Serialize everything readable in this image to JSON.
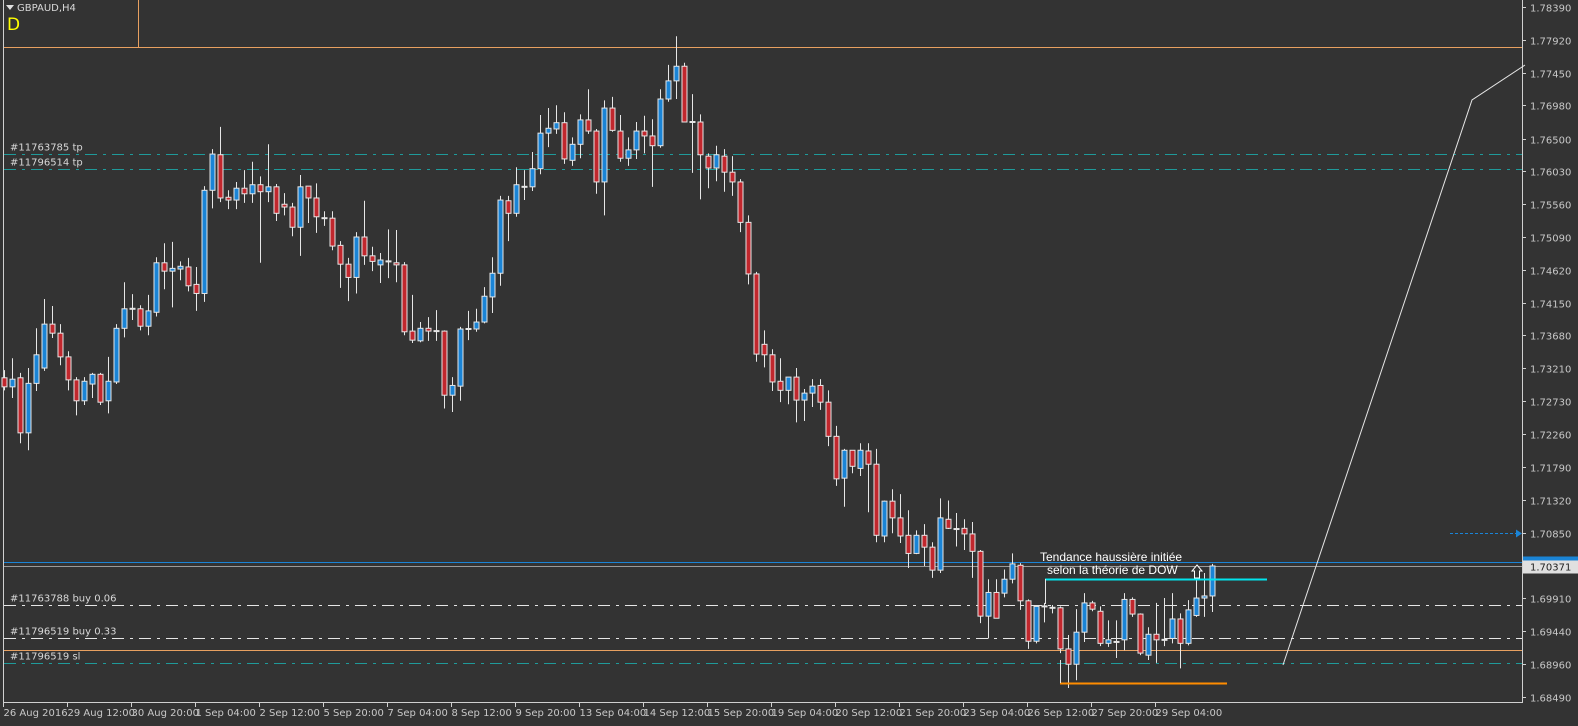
{
  "header": {
    "symbol": "GBPAUD,H4",
    "timeframe_marker": "D"
  },
  "colors": {
    "background": "#333333",
    "bull": "#1a84d6",
    "bear": "#c1272d",
    "candle_outline": "#e6e6e6",
    "axis_text": "#c8c8c8"
  },
  "annotation": {
    "line1": "Tendance haussière initiée",
    "line2": "selon la théorie de DOW",
    "arrow_icon": "up-arrow"
  },
  "current_price": {
    "bid": "1.70371",
    "bid_value": 1.70371,
    "ask_value": 1.7043
  },
  "alert_level": 1.7085,
  "order_lines": [
    {
      "label": "#11763785 tp",
      "price": 1.7628,
      "color": "#1f9a9a",
      "style": "dashdot"
    },
    {
      "label": "#11796514 tp",
      "price": 1.7606,
      "color": "#1f9a9a",
      "style": "dashdot"
    },
    {
      "label": "#11763788 buy 0.06",
      "price": 1.6981,
      "color": "#e6e6e6",
      "style": "dashdot"
    },
    {
      "label": "#11796519 buy 0.33",
      "price": 1.6933,
      "color": "#e6e6e6",
      "style": "dashdot"
    },
    {
      "label": "#11796519 sl",
      "price": 1.6898,
      "color": "#1f9a9a",
      "style": "dashdot"
    }
  ],
  "horizontal_lines": [
    {
      "price": 1.7782,
      "color": "#e8a060"
    },
    {
      "price": 1.6916,
      "color": "#e8a060"
    }
  ],
  "chart_data": {
    "type": "candlestick",
    "title": "GBPAUD,H4",
    "ylim": [
      1.6849,
      1.7839
    ],
    "grid": false,
    "y_ticks": [
      "1.78390",
      "1.77920",
      "1.77450",
      "1.76980",
      "1.76500",
      "1.76030",
      "1.75560",
      "1.75090",
      "1.74620",
      "1.74150",
      "1.73680",
      "1.73210",
      "1.72730",
      "1.72260",
      "1.71790",
      "1.71320",
      "1.70850",
      "1.69910",
      "1.69440",
      "1.68960",
      "1.68490"
    ],
    "x_ticks": [
      "26 Aug 2016",
      "29 Aug 12:00",
      "30 Aug 20:00",
      "1 Sep 04:00",
      "2 Sep 12:00",
      "5 Sep 20:00",
      "7 Sep 04:00",
      "8 Sep 12:00",
      "9 Sep 20:00",
      "13 Sep 04:00",
      "14 Sep 12:00",
      "15 Sep 20:00",
      "19 Sep 04:00",
      "20 Sep 12:00",
      "21 Sep 20:00",
      "23 Sep 04:00",
      "26 Sep 12:00",
      "27 Sep 20:00",
      "29 Sep 04:00"
    ],
    "ohlc_fields": [
      "open",
      "high",
      "low",
      "close"
    ],
    "candles": [
      [
        1.7307,
        1.7318,
        1.7289,
        1.7294
      ],
      [
        1.7294,
        1.7335,
        1.7278,
        1.7305
      ],
      [
        1.7307,
        1.7314,
        1.7213,
        1.7228
      ],
      [
        1.7228,
        1.7321,
        1.7203,
        1.7299
      ],
      [
        1.7299,
        1.7378,
        1.7288,
        1.734
      ],
      [
        1.7321,
        1.742,
        1.7317,
        1.7384
      ],
      [
        1.7384,
        1.741,
        1.7364,
        1.7371
      ],
      [
        1.7371,
        1.7384,
        1.7325,
        1.7337
      ],
      [
        1.7337,
        1.7345,
        1.7289,
        1.7304
      ],
      [
        1.7304,
        1.7308,
        1.7253,
        1.7274
      ],
      [
        1.7274,
        1.7308,
        1.7268,
        1.7302
      ],
      [
        1.7298,
        1.7314,
        1.7278,
        1.7312
      ],
      [
        1.7312,
        1.7314,
        1.7268,
        1.7272
      ],
      [
        1.7274,
        1.7337,
        1.7256,
        1.7302
      ],
      [
        1.7301,
        1.7384,
        1.7298,
        1.7378
      ],
      [
        1.7378,
        1.7444,
        1.7365,
        1.7406
      ],
      [
        1.7406,
        1.7427,
        1.739,
        1.7406
      ],
      [
        1.7406,
        1.7411,
        1.7375,
        1.7381
      ],
      [
        1.7381,
        1.7426,
        1.7368,
        1.7403
      ],
      [
        1.7401,
        1.748,
        1.7395,
        1.7472
      ],
      [
        1.7472,
        1.75,
        1.7434,
        1.746
      ],
      [
        1.746,
        1.7502,
        1.7408,
        1.7464
      ],
      [
        1.7463,
        1.7474,
        1.7447,
        1.7467
      ],
      [
        1.7466,
        1.7479,
        1.7431,
        1.7439
      ],
      [
        1.7441,
        1.7466,
        1.7403,
        1.7428
      ],
      [
        1.7428,
        1.7582,
        1.7416,
        1.7576
      ],
      [
        1.7576,
        1.7635,
        1.755,
        1.7628
      ],
      [
        1.7627,
        1.7667,
        1.7559,
        1.7565
      ],
      [
        1.7566,
        1.7576,
        1.7549,
        1.7562
      ],
      [
        1.7562,
        1.7588,
        1.7549,
        1.7579
      ],
      [
        1.7579,
        1.7605,
        1.7558,
        1.7571
      ],
      [
        1.7571,
        1.7617,
        1.7558,
        1.7584
      ],
      [
        1.7584,
        1.7596,
        1.7472,
        1.7574
      ],
      [
        1.7574,
        1.7642,
        1.7559,
        1.7581
      ],
      [
        1.7581,
        1.7585,
        1.7532,
        1.7543
      ],
      [
        1.7556,
        1.7572,
        1.754,
        1.7552
      ],
      [
        1.7552,
        1.7558,
        1.751,
        1.7523
      ],
      [
        1.7523,
        1.7598,
        1.7482,
        1.7581
      ],
      [
        1.7582,
        1.7582,
        1.7529,
        1.7565
      ],
      [
        1.7565,
        1.7586,
        1.7515,
        1.7538
      ],
      [
        1.7536,
        1.7546,
        1.7525,
        1.7536
      ],
      [
        1.7536,
        1.7546,
        1.749,
        1.7496
      ],
      [
        1.7497,
        1.7503,
        1.7436,
        1.747
      ],
      [
        1.747,
        1.7479,
        1.7417,
        1.7451
      ],
      [
        1.7451,
        1.7516,
        1.7428,
        1.7509
      ],
      [
        1.7509,
        1.7561,
        1.7469,
        1.7482
      ],
      [
        1.7482,
        1.7495,
        1.746,
        1.7474
      ],
      [
        1.7469,
        1.7486,
        1.7443,
        1.7476
      ],
      [
        1.7474,
        1.752,
        1.745,
        1.7472
      ],
      [
        1.7472,
        1.7519,
        1.7444,
        1.7469
      ],
      [
        1.7469,
        1.7473,
        1.7368,
        1.7373
      ],
      [
        1.7374,
        1.7426,
        1.7357,
        1.7361
      ],
      [
        1.736,
        1.7387,
        1.7358,
        1.7378
      ],
      [
        1.7378,
        1.7394,
        1.736,
        1.7374
      ],
      [
        1.7374,
        1.7404,
        1.736,
        1.7374
      ],
      [
        1.7374,
        1.7375,
        1.7263,
        1.7282
      ],
      [
        1.7282,
        1.7308,
        1.7258,
        1.7296
      ],
      [
        1.7295,
        1.738,
        1.7274,
        1.7377
      ],
      [
        1.7377,
        1.7403,
        1.7361,
        1.7377
      ],
      [
        1.7377,
        1.7406,
        1.7373,
        1.7387
      ],
      [
        1.7387,
        1.7437,
        1.7385,
        1.7424
      ],
      [
        1.7423,
        1.748,
        1.74,
        1.7457
      ],
      [
        1.7457,
        1.7568,
        1.7439,
        1.7562
      ],
      [
        1.7561,
        1.7568,
        1.7503,
        1.7543
      ],
      [
        1.7543,
        1.7609,
        1.7538,
        1.7584
      ],
      [
        1.7581,
        1.7605,
        1.7562,
        1.7581
      ],
      [
        1.7581,
        1.7631,
        1.7575,
        1.7607
      ],
      [
        1.7607,
        1.7684,
        1.7599,
        1.7658
      ],
      [
        1.7658,
        1.7694,
        1.7638,
        1.7665
      ],
      [
        1.7664,
        1.7698,
        1.7657,
        1.7673
      ],
      [
        1.7673,
        1.7688,
        1.7614,
        1.7621
      ],
      [
        1.7619,
        1.7652,
        1.7611,
        1.7642
      ],
      [
        1.7642,
        1.7685,
        1.7622,
        1.7677
      ],
      [
        1.7677,
        1.7721,
        1.7657,
        1.7661
      ],
      [
        1.7661,
        1.7664,
        1.7571,
        1.7588
      ],
      [
        1.7588,
        1.7705,
        1.754,
        1.7694
      ],
      [
        1.7694,
        1.771,
        1.766,
        1.7662
      ],
      [
        1.7661,
        1.7684,
        1.7617,
        1.7622
      ],
      [
        1.7622,
        1.7652,
        1.7611,
        1.7634
      ],
      [
        1.7634,
        1.7674,
        1.7621,
        1.7661
      ],
      [
        1.7661,
        1.7683,
        1.7629,
        1.7654
      ],
      [
        1.7654,
        1.7678,
        1.7581,
        1.764
      ],
      [
        1.764,
        1.7721,
        1.7637,
        1.7707
      ],
      [
        1.7707,
        1.7756,
        1.7703,
        1.7733
      ],
      [
        1.7733,
        1.7797,
        1.7707,
        1.7754
      ],
      [
        1.7754,
        1.7759,
        1.7674,
        1.7674
      ],
      [
        1.7674,
        1.7714,
        1.7601,
        1.7674
      ],
      [
        1.7674,
        1.7685,
        1.7563,
        1.7627
      ],
      [
        1.7625,
        1.7629,
        1.7579,
        1.7608
      ],
      [
        1.7608,
        1.764,
        1.7589,
        1.7627
      ],
      [
        1.7625,
        1.7635,
        1.7574,
        1.7602
      ],
      [
        1.7602,
        1.7625,
        1.7568,
        1.7588
      ],
      [
        1.7588,
        1.7592,
        1.7516,
        1.753
      ],
      [
        1.753,
        1.754,
        1.7441,
        1.7456
      ],
      [
        1.7456,
        1.7459,
        1.733,
        1.7341
      ],
      [
        1.7355,
        1.7375,
        1.7322,
        1.734
      ],
      [
        1.734,
        1.7348,
        1.7288,
        1.7301
      ],
      [
        1.7302,
        1.7335,
        1.7272,
        1.7289
      ],
      [
        1.7289,
        1.7308,
        1.7269,
        1.7308
      ],
      [
        1.7308,
        1.7321,
        1.7243,
        1.7275
      ],
      [
        1.7275,
        1.7291,
        1.7245,
        1.7285
      ],
      [
        1.7285,
        1.7305,
        1.7265,
        1.7295
      ],
      [
        1.7296,
        1.7305,
        1.7261,
        1.7272
      ],
      [
        1.7272,
        1.7289,
        1.7209,
        1.7223
      ],
      [
        1.7223,
        1.7238,
        1.7152,
        1.7162
      ],
      [
        1.7163,
        1.7205,
        1.7122,
        1.7203
      ],
      [
        1.7203,
        1.7203,
        1.717,
        1.718
      ],
      [
        1.7177,
        1.7213,
        1.7166,
        1.7203
      ],
      [
        1.7202,
        1.7213,
        1.7114,
        1.7183
      ],
      [
        1.7183,
        1.7205,
        1.7071,
        1.7081
      ],
      [
        1.708,
        1.7131,
        1.7071,
        1.713
      ],
      [
        1.713,
        1.7147,
        1.7084,
        1.7106
      ],
      [
        1.7106,
        1.714,
        1.707,
        1.708
      ],
      [
        1.7081,
        1.7117,
        1.7034,
        1.7055
      ],
      [
        1.7055,
        1.7088,
        1.7054,
        1.7081
      ],
      [
        1.7081,
        1.7097,
        1.7037,
        1.7064
      ],
      [
        1.7064,
        1.7071,
        1.702,
        1.7031
      ],
      [
        1.7031,
        1.7134,
        1.7027,
        1.7106
      ],
      [
        1.7104,
        1.7131,
        1.709,
        1.7091
      ],
      [
        1.709,
        1.7113,
        1.7065,
        1.709
      ],
      [
        1.7091,
        1.7104,
        1.706,
        1.7083
      ],
      [
        1.7083,
        1.71,
        1.702,
        1.7058
      ],
      [
        1.7058,
        1.706,
        1.6955,
        1.6965
      ],
      [
        1.6965,
        1.7018,
        1.6933,
        1.6999
      ],
      [
        1.6999,
        1.7018,
        1.6962,
        1.6962
      ],
      [
        1.6998,
        1.7032,
        1.6992,
        1.7018
      ],
      [
        1.7018,
        1.7055,
        1.7012,
        1.704
      ],
      [
        1.7038,
        1.7041,
        1.6974,
        1.6987
      ],
      [
        1.6987,
        1.6989,
        1.6918,
        1.6929
      ],
      [
        1.6929,
        1.6981,
        1.6926,
        1.6979
      ],
      [
        1.6979,
        1.6984,
        1.6956,
        1.6979
      ],
      [
        1.6977,
        1.6981,
        1.6969,
        1.6977
      ],
      [
        1.6977,
        1.6979,
        1.6912,
        1.6918
      ],
      [
        1.6918,
        1.6938,
        1.6862,
        1.6896
      ],
      [
        1.6896,
        1.6975,
        1.6873,
        1.6942
      ],
      [
        1.6942,
        1.6998,
        1.6928,
        1.6984
      ],
      [
        1.6984,
        1.6987,
        1.6972,
        1.6975
      ],
      [
        1.6972,
        1.6979,
        1.6922,
        1.6926
      ],
      [
        1.6926,
        1.6959,
        1.6921,
        1.6931
      ],
      [
        1.6928,
        1.6959,
        1.6905,
        1.6928
      ],
      [
        1.6931,
        1.6998,
        1.6916,
        1.6989
      ],
      [
        1.6989,
        1.6992,
        1.6964,
        1.6968
      ],
      [
        1.6968,
        1.6969,
        1.6909,
        1.6912
      ],
      [
        1.6909,
        1.6949,
        1.6902,
        1.6939
      ],
      [
        1.6939,
        1.6984,
        1.6898,
        1.6931
      ],
      [
        1.6931,
        1.6991,
        1.6922,
        1.6931
      ],
      [
        1.6933,
        1.6998,
        1.6926,
        1.6961
      ],
      [
        1.6961,
        1.6969,
        1.689,
        1.6926
      ],
      [
        1.6926,
        1.6988,
        1.6923,
        1.6974
      ],
      [
        1.6966,
        1.702,
        1.6964,
        1.6991
      ],
      [
        1.6991,
        1.7027,
        1.6964,
        1.6994
      ],
      [
        1.6994,
        1.704,
        1.6971,
        1.7037
      ]
    ]
  }
}
